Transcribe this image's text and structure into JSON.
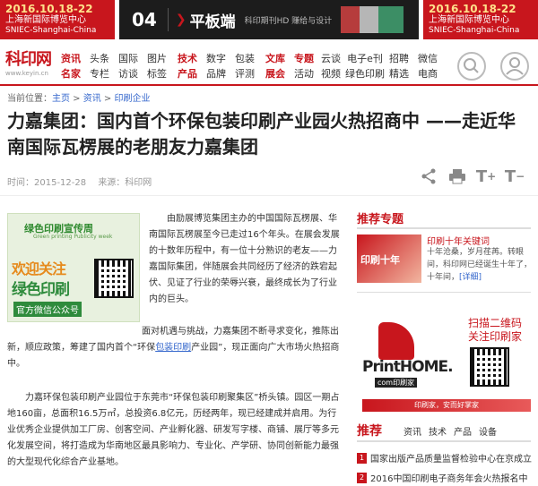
{
  "banner": {
    "expo_date": "2016.10.18-22",
    "expo_title": "上海新国际博览中心",
    "expo_place": "SNIEC-Shanghai-China",
    "ad_num": "04",
    "ad_product": "平板端",
    "ad_sub": "科印期刊HD 赚给与设计"
  },
  "logo": {
    "name": "科印网",
    "url": "www.keyin.cn"
  },
  "nav": {
    "col1": [
      "资讯",
      "名家"
    ],
    "col2": [
      "头条",
      "专栏"
    ],
    "col3": [
      "国际",
      "访谈"
    ],
    "col4": [
      "图片",
      "标签"
    ],
    "col5": [
      "技术",
      "产品"
    ],
    "col6": [
      "数字",
      "品牌"
    ],
    "col7": [
      "包装",
      "评测"
    ],
    "col8": [
      "文库",
      "展会"
    ],
    "col9": [
      "专题",
      "活动"
    ],
    "col10": [
      "云谈",
      "视频"
    ],
    "col11": [
      "电子e刊",
      "绿色印刷"
    ],
    "col12": [
      "招聘",
      "精选"
    ],
    "col13": [
      "微信",
      "电商"
    ]
  },
  "breadcrumb": {
    "prefix": "当前位置：",
    "home": "主页",
    "sep1": " > ",
    "news": "资讯",
    "sep2": " > ",
    "cat": "印刷企业"
  },
  "article": {
    "title": "力嘉集团：国内首个环保包装印刷产业园火热招商中 ——走近华南国际瓦楞展的老朋友力嘉集团",
    "time": "时间：2015-12-28",
    "source": "来源：科印网",
    "p1": "由励展博览集团主办的中国国际瓦楞展、华南国际瓦楞展至今已走过16个年头。在展会发展的十数年历程中，有一位十分熟识的老友——力嘉国际集团，伴随展会共同经历了经济的跌宕起伏、见证了行业的荣辱兴衰，最终成长为了行业内的巨头。",
    "p2a": "面对机遇与挑战，力嘉集团不断寻求变化，推陈出新，顺应政策，筹建了国内首个“环保",
    "p2link": "包装印刷",
    "p2b": "产业园”，现正面向广大市场火热招商中。",
    "p3": "力嘉环保包装印刷产业园位于东莞市“环保包装印刷聚集区”桥头镇。园区一期占地160亩，总面积16.5万㎡，总投资6.8亿元，历经两年，现已经建成并启用。为行业优秀企业提供加工厂房、创客空间、产业孵化器、研发写字楼、商铺、展厅等多元化发展空间，将打造成为华南地区最具影响力、专业化、产学研、协同创新能力最强的大型现代化综合产业基地。"
  },
  "ad": {
    "header": "绿色印刷宣传周",
    "sub": "Green printing Publicity week",
    "line1": "欢迎关注",
    "line2": "绿色印刷",
    "line3": "官方微信公众号"
  },
  "sidebar": {
    "topic_head": "推荐专题",
    "img_text": "印刷十年",
    "news_title": "印刷十年关键词",
    "news_text": "十年沧桑，岁月荏苒。转眼间，科印网已经诞生十年了，十年间，",
    "news_more": "[详细]",
    "scan1": "扫描二维码",
    "scan2": "关注印刷家",
    "brand": "PrintHOME.",
    "brand_com": "com印刷家",
    "slogan": "印刷家，安而好掌家",
    "rec_head": "推荐",
    "tabs": [
      "资讯",
      "技术",
      "产品",
      "设备"
    ],
    "items": [
      {
        "n": "1",
        "text": "国家出版产品质量监督检验中心在京成立"
      },
      {
        "n": "2",
        "text": "2016中国印刷电子商务年会火热报名中"
      }
    ]
  },
  "colors": {
    "accent": "#c8161d",
    "link": "#3366cc"
  },
  "icons": [
    "search-icon",
    "user-icon",
    "share-icon",
    "print-icon",
    "font-increase-icon",
    "font-decrease-icon"
  ]
}
